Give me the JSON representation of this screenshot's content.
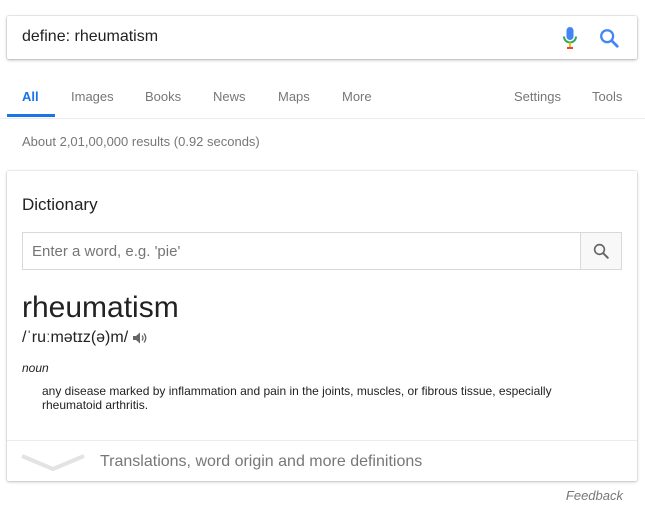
{
  "search": {
    "query": "define: rheumatism"
  },
  "tabs": [
    {
      "label": "All"
    },
    {
      "label": "Images"
    },
    {
      "label": "Books"
    },
    {
      "label": "News"
    },
    {
      "label": "Maps"
    },
    {
      "label": "More"
    },
    {
      "label": "Settings"
    },
    {
      "label": "Tools"
    }
  ],
  "result_stats": "About 2,01,00,000 results (0.92 seconds)",
  "dictionary": {
    "title": "Dictionary",
    "input_placeholder": "Enter a word, e.g. 'pie'",
    "word": "rheumatism",
    "pronunciation": "/ˈruːmətɪz(ə)m/",
    "part_of_speech": "noun",
    "definition": "any disease marked by inflammation and pain in the joints, muscles, or fibrous tissue, especially rheumatoid arthritis.",
    "more_link": "Translations, word origin and more definitions"
  },
  "feedback": "Feedback",
  "colors": {
    "accent": "#1a73e8",
    "muted": "#777777"
  }
}
